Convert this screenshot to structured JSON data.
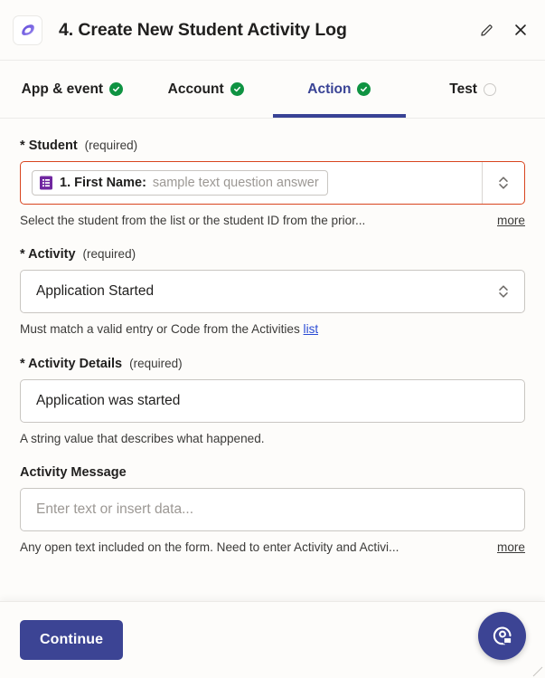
{
  "header": {
    "title": "4. Create New Student Activity Log",
    "app_icon_name": "zapier-app-logo",
    "edit_label": "Edit",
    "close_label": "Close"
  },
  "tabs": [
    {
      "label": "App & event",
      "state": "complete"
    },
    {
      "label": "Account",
      "state": "complete"
    },
    {
      "label": "Action",
      "state": "complete",
      "active": true
    },
    {
      "label": "Test",
      "state": "incomplete"
    }
  ],
  "fields": [
    {
      "label": "Student",
      "required_text": "(required)",
      "required_marker": "*",
      "type": "token-select",
      "invalid": true,
      "token": {
        "icon": "google-forms-icon",
        "label": "1. First Name:",
        "value": "sample text question answer"
      },
      "help": "Select the student from the list or the student ID from the prior...",
      "more_label": "more"
    },
    {
      "label": "Activity",
      "required_text": "(required)",
      "required_marker": "*",
      "type": "select",
      "value": "Application Started",
      "help_prefix": "Must match a valid entry or Code from the Activities ",
      "help_link": "list"
    },
    {
      "label": "Activity Details",
      "required_text": "(required)",
      "required_marker": "*",
      "type": "text",
      "value": "Application was started",
      "help": "A string value that describes what happened."
    },
    {
      "label": "Activity Message",
      "required_text": "",
      "required_marker": "",
      "type": "text",
      "value": "",
      "placeholder": "Enter text or insert data...",
      "help": "Any open text included on the form. Need to enter Activity and Activi...",
      "more_label": "more"
    }
  ],
  "footer": {
    "continue_label": "Continue",
    "help_fab_name": "support-chat-icon"
  },
  "colors": {
    "accent": "#3c4494",
    "tab_active": "#394395",
    "check_green": "#0f9342",
    "error_border": "#d8451f",
    "link_blue": "#2a4bd4",
    "background": "#fdfcfa"
  }
}
